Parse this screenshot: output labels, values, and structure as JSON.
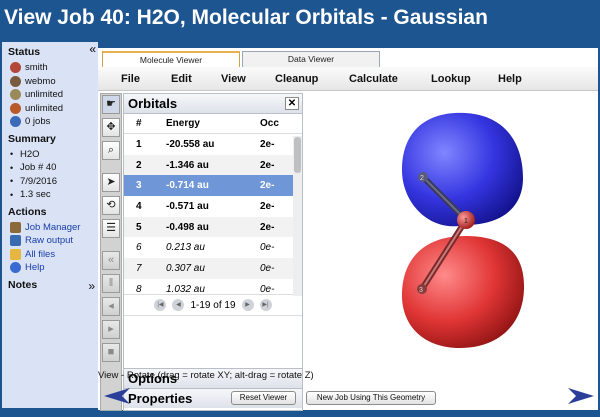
{
  "window_title": "View Job 40: H2O, Molecular Orbitals - Gaussian",
  "sidebar": {
    "collapse_icon": "«",
    "status_heading": "Status",
    "status_items": [
      {
        "icon": "user-icon",
        "label": "smith",
        "color": "#b3473a"
      },
      {
        "icon": "webmo-icon",
        "label": "webmo",
        "color": "#7a5a3c"
      },
      {
        "icon": "disk-icon",
        "label": "unlimited",
        "color": "#9a8a5a"
      },
      {
        "icon": "clock-icon",
        "label": "unlimited",
        "color": "#b85a2a"
      },
      {
        "icon": "jobs-icon",
        "label": "0 jobs",
        "color": "#3b6ab8"
      }
    ],
    "summary_heading": "Summary",
    "summary_items": [
      "H2O",
      "Job # 40",
      "7/9/2016",
      "1.3 sec"
    ],
    "actions_heading": "Actions",
    "actions": [
      {
        "icon": "job-manager-icon",
        "label": "Job Manager",
        "color": "#8a6a3a"
      },
      {
        "icon": "raw-output-icon",
        "label": "Raw output",
        "color": "#3a6ab0"
      },
      {
        "icon": "folder-icon",
        "label": "All files",
        "color": "#e6b640"
      },
      {
        "icon": "help-icon",
        "label": "Help",
        "color": "#3a6ad0"
      }
    ],
    "notes_heading": "Notes",
    "notes_expand_icon": "»"
  },
  "tabs": [
    {
      "label": "Molecule Viewer",
      "active": true
    },
    {
      "label": "Data Viewer",
      "active": false
    }
  ],
  "menu": [
    "File",
    "Edit",
    "View",
    "Cleanup",
    "Calculate",
    "Lookup",
    "Help"
  ],
  "toolbar": [
    {
      "icon": "rotate-hand-icon",
      "glyph": "☛"
    },
    {
      "icon": "translate-icon",
      "glyph": "✥"
    },
    {
      "icon": "zoom-icon",
      "glyph": "⌕"
    },
    {
      "icon": "select-arrow-icon",
      "glyph": "➤"
    },
    {
      "icon": "adjust-icon",
      "glyph": "⟲"
    },
    {
      "icon": "list-icon",
      "glyph": "☰"
    },
    {
      "icon": "rewind-icon",
      "glyph": "«"
    },
    {
      "icon": "pause-icon",
      "glyph": "‖"
    },
    {
      "icon": "step-back-icon",
      "glyph": "◂"
    },
    {
      "icon": "step-forward-icon",
      "glyph": "▸"
    },
    {
      "icon": "stop-icon",
      "glyph": "■"
    }
  ],
  "orbitals": {
    "title": "Orbitals",
    "close_glyph": "✕",
    "columns": [
      "#",
      "Energy",
      "Occ"
    ],
    "rows": [
      {
        "num": "1",
        "energy": "-20.558 au",
        "occ": "2e-"
      },
      {
        "num": "2",
        "energy": "-1.346 au",
        "occ": "2e-"
      },
      {
        "num": "3",
        "energy": "-0.714 au",
        "occ": "2e-"
      },
      {
        "num": "4",
        "energy": "-0.571 au",
        "occ": "2e-"
      },
      {
        "num": "5",
        "energy": "-0.498 au",
        "occ": "2e-"
      },
      {
        "num": "6",
        "energy": "0.213 au",
        "occ": "0e-"
      },
      {
        "num": "7",
        "energy": "0.307 au",
        "occ": "0e-"
      },
      {
        "num": "8",
        "energy": "1.032 au",
        "occ": "0e-"
      }
    ],
    "selected_row": 3,
    "pager_text": "1-19 of 19"
  },
  "options_heading": "Options",
  "properties_heading": "Properties",
  "status_text": "View - Rotate (drag = rotate XY; alt-drag = rotate Z)",
  "buttons": {
    "reset": "Reset Viewer",
    "new_job": "New Job Using This Geometry"
  },
  "atom_labels": [
    "1",
    "2",
    "3"
  ],
  "colors": {
    "background": "#1d5591",
    "sidebar": "#d9e3f5",
    "selected_row": "#6f96d6",
    "lobe_blue": "#2b2bd6",
    "lobe_red": "#d62b2b"
  }
}
